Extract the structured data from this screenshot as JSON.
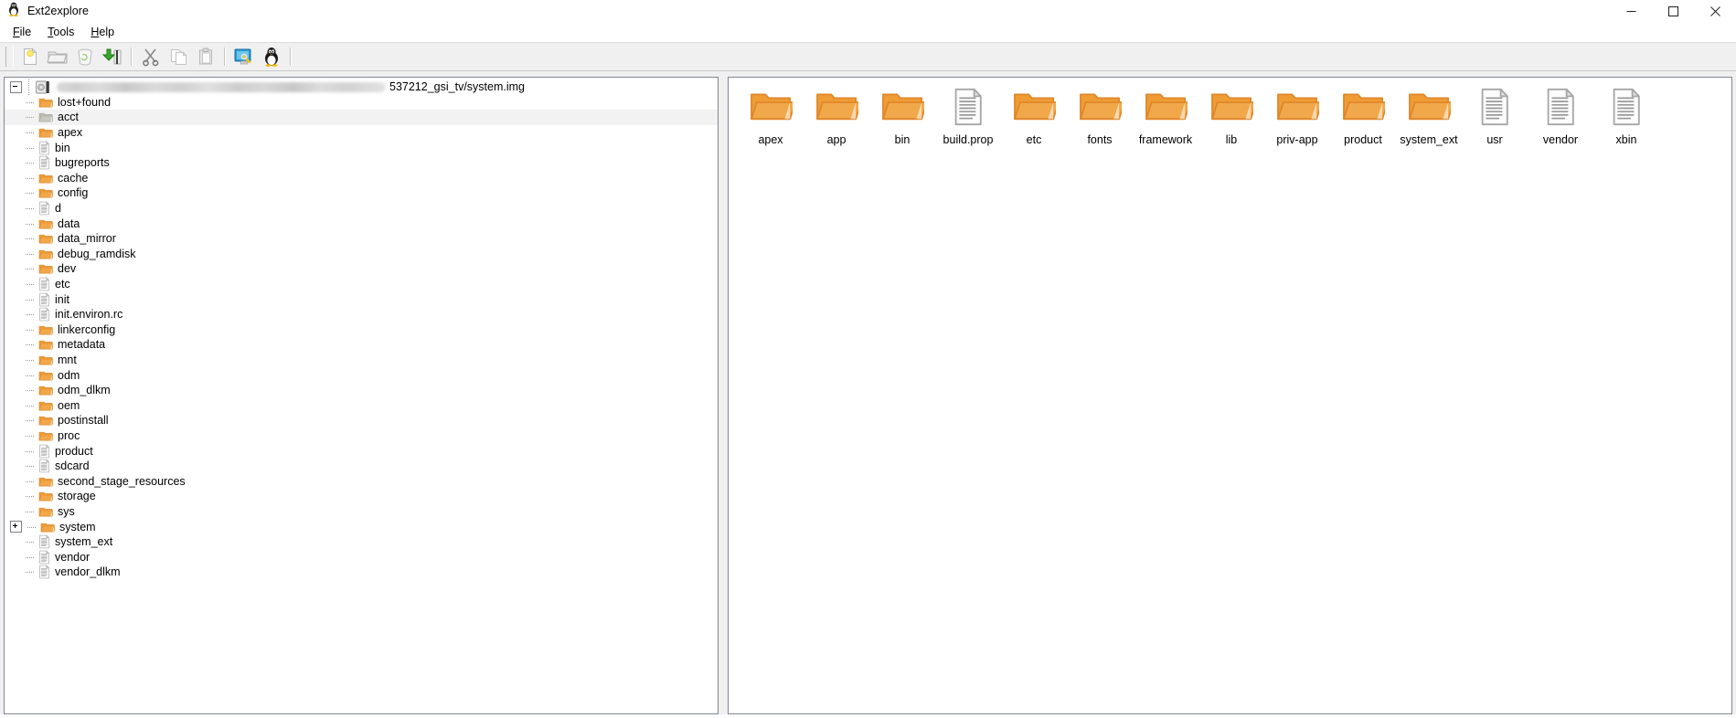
{
  "window": {
    "title": "Ext2explore",
    "app_icon": "tux-penguin-icon",
    "controls": {
      "minimize": "minimize-icon",
      "maximize": "maximize-icon",
      "close": "close-icon"
    }
  },
  "menubar": {
    "items": [
      {
        "label": "File",
        "mnemonic": "F"
      },
      {
        "label": "Tools",
        "mnemonic": "T"
      },
      {
        "label": "Help",
        "mnemonic": "H"
      }
    ]
  },
  "toolbar": {
    "buttons": [
      {
        "name": "new-file-icon",
        "enabled": false
      },
      {
        "name": "open-folder-icon",
        "enabled": false
      },
      {
        "name": "recycle-bin-icon",
        "enabled": false
      },
      {
        "name": "save-to-disk-icon",
        "enabled": true
      },
      {
        "name": "cut-scissors-icon",
        "enabled": true
      },
      {
        "name": "copy-icon",
        "enabled": false
      },
      {
        "name": "paste-icon",
        "enabled": false
      },
      {
        "name": "scan-disk-icon",
        "enabled": true
      },
      {
        "name": "linux-tux-icon",
        "enabled": true
      }
    ]
  },
  "tree": {
    "root": {
      "label": "537212_gsi_tv/system.img",
      "redacted_prefix": true,
      "icon": "disk-image-icon",
      "expanded": true
    },
    "items": [
      {
        "label": "lost+found",
        "icon": "folder",
        "selected": false,
        "expandable": false
      },
      {
        "label": "acct",
        "icon": "folder-selected",
        "selected": true,
        "expandable": false
      },
      {
        "label": "apex",
        "icon": "folder",
        "selected": false,
        "expandable": false
      },
      {
        "label": "bin",
        "icon": "file",
        "selected": false,
        "expandable": false
      },
      {
        "label": "bugreports",
        "icon": "file",
        "selected": false,
        "expandable": false
      },
      {
        "label": "cache",
        "icon": "folder",
        "selected": false,
        "expandable": false
      },
      {
        "label": "config",
        "icon": "folder",
        "selected": false,
        "expandable": false
      },
      {
        "label": "d",
        "icon": "file",
        "selected": false,
        "expandable": false
      },
      {
        "label": "data",
        "icon": "folder",
        "selected": false,
        "expandable": false
      },
      {
        "label": "data_mirror",
        "icon": "folder",
        "selected": false,
        "expandable": false
      },
      {
        "label": "debug_ramdisk",
        "icon": "folder",
        "selected": false,
        "expandable": false
      },
      {
        "label": "dev",
        "icon": "folder",
        "selected": false,
        "expandable": false
      },
      {
        "label": "etc",
        "icon": "file",
        "selected": false,
        "expandable": false
      },
      {
        "label": "init",
        "icon": "file",
        "selected": false,
        "expandable": false
      },
      {
        "label": "init.environ.rc",
        "icon": "file",
        "selected": false,
        "expandable": false
      },
      {
        "label": "linkerconfig",
        "icon": "folder",
        "selected": false,
        "expandable": false
      },
      {
        "label": "metadata",
        "icon": "folder",
        "selected": false,
        "expandable": false
      },
      {
        "label": "mnt",
        "icon": "folder",
        "selected": false,
        "expandable": false
      },
      {
        "label": "odm",
        "icon": "folder",
        "selected": false,
        "expandable": false
      },
      {
        "label": "odm_dlkm",
        "icon": "folder",
        "selected": false,
        "expandable": false
      },
      {
        "label": "oem",
        "icon": "folder",
        "selected": false,
        "expandable": false
      },
      {
        "label": "postinstall",
        "icon": "folder",
        "selected": false,
        "expandable": false
      },
      {
        "label": "proc",
        "icon": "folder",
        "selected": false,
        "expandable": false
      },
      {
        "label": "product",
        "icon": "file",
        "selected": false,
        "expandable": false
      },
      {
        "label": "sdcard",
        "icon": "file",
        "selected": false,
        "expandable": false
      },
      {
        "label": "second_stage_resources",
        "icon": "folder",
        "selected": false,
        "expandable": false
      },
      {
        "label": "storage",
        "icon": "folder",
        "selected": false,
        "expandable": false
      },
      {
        "label": "sys",
        "icon": "folder",
        "selected": false,
        "expandable": false
      },
      {
        "label": "system",
        "icon": "folder",
        "selected": false,
        "expandable": true
      },
      {
        "label": "system_ext",
        "icon": "file",
        "selected": false,
        "expandable": false
      },
      {
        "label": "vendor",
        "icon": "file",
        "selected": false,
        "expandable": false
      },
      {
        "label": "vendor_dlkm",
        "icon": "file",
        "selected": false,
        "expandable": false
      }
    ]
  },
  "contents": {
    "items": [
      {
        "label": "apex",
        "icon": "folder"
      },
      {
        "label": "app",
        "icon": "folder"
      },
      {
        "label": "bin",
        "icon": "folder"
      },
      {
        "label": "build.prop",
        "icon": "file"
      },
      {
        "label": "etc",
        "icon": "folder"
      },
      {
        "label": "fonts",
        "icon": "folder"
      },
      {
        "label": "framework",
        "icon": "folder"
      },
      {
        "label": "lib",
        "icon": "folder"
      },
      {
        "label": "priv-app",
        "icon": "folder"
      },
      {
        "label": "product",
        "icon": "folder"
      },
      {
        "label": "system_ext",
        "icon": "folder"
      },
      {
        "label": "usr",
        "icon": "file"
      },
      {
        "label": "vendor",
        "icon": "file"
      },
      {
        "label": "xbin",
        "icon": "file"
      }
    ]
  },
  "colors": {
    "folder_orange": "#ee9a3a",
    "folder_orange_dark": "#d8791c",
    "selected_row": "#f2f2f2",
    "toolbar_bg": "#f0f0f0",
    "panel_border": "#828790"
  }
}
